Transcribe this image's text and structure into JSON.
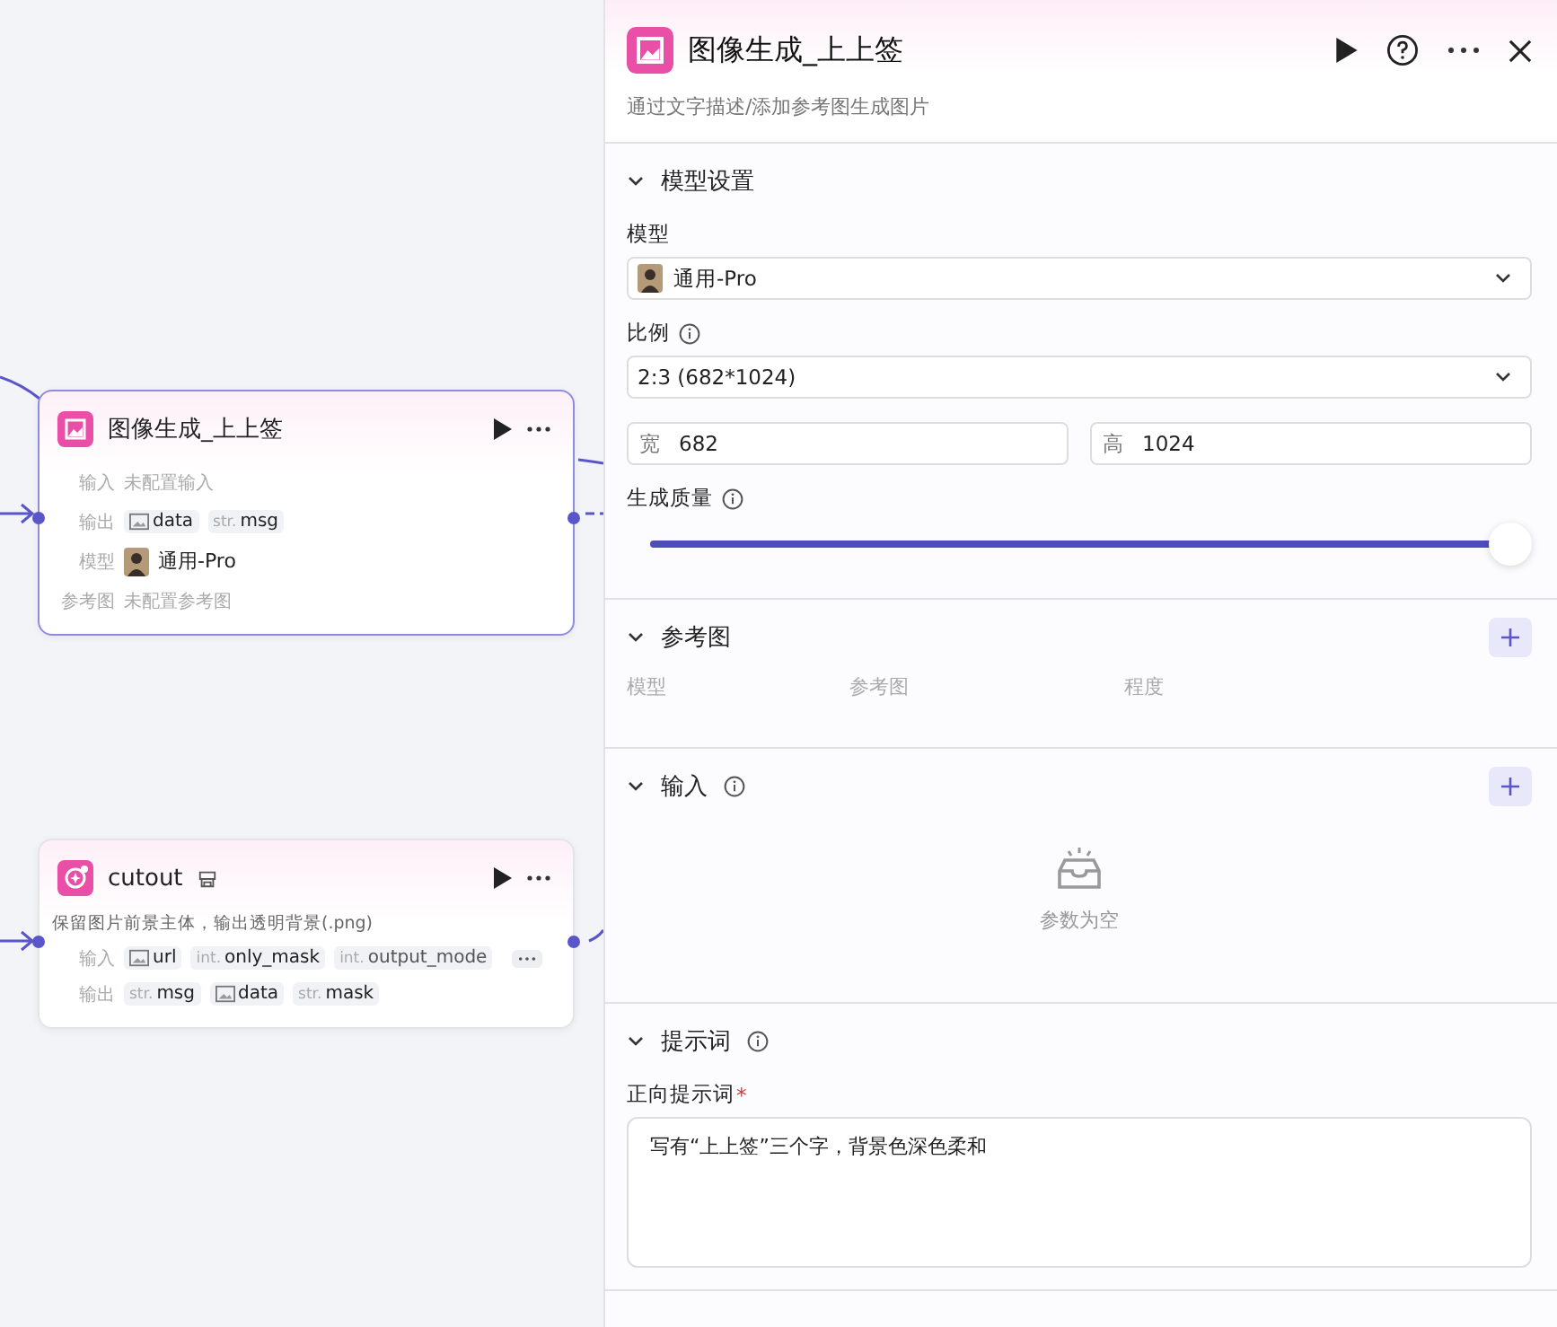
{
  "canvas": {
    "nodes": [
      {
        "title": "图像生成_上上签",
        "badge": false,
        "rows": [
          {
            "label": "输入",
            "kind": "empty",
            "value": "未配置输入"
          },
          {
            "label": "输出",
            "kind": "tags",
            "tags": [
              {
                "kind": "image",
                "name": "data"
              },
              {
                "kind": "typed",
                "prefix": "str.",
                "name": "msg"
              }
            ]
          },
          {
            "label": "模型",
            "kind": "model",
            "value": "通用-Pro"
          },
          {
            "label": "参考图",
            "kind": "empty",
            "value": "未配置参考图"
          }
        ]
      },
      {
        "title": "cutout",
        "badge": true,
        "description": "保留图片前景主体，输出透明背景(.png)",
        "rows": [
          {
            "label": "输入",
            "kind": "tags",
            "more": true,
            "tags": [
              {
                "kind": "image",
                "name": "url"
              },
              {
                "kind": "typed",
                "prefix": "int.",
                "name": "only_mask"
              },
              {
                "kind": "typed",
                "prefix": "int.",
                "name": "output_mode",
                "faded": true
              }
            ]
          },
          {
            "label": "输出",
            "kind": "tags",
            "tags": [
              {
                "kind": "typed",
                "prefix": "str.",
                "name": "msg"
              },
              {
                "kind": "image",
                "name": "data"
              },
              {
                "kind": "typed",
                "prefix": "str.",
                "name": "mask"
              }
            ]
          }
        ]
      }
    ]
  },
  "panel": {
    "title": "图像生成_上上签",
    "description": "通过文字描述/添加参考图生成图片",
    "sections": [
      {
        "kind": "settings",
        "title": "模型设置",
        "info": false,
        "add": false,
        "expanded": true,
        "model": {
          "label": "模型",
          "value": "通用-Pro"
        },
        "ratio": {
          "label": "比例",
          "value": "2:3 (682*1024)"
        },
        "width": {
          "label": "宽",
          "value": "682"
        },
        "height": {
          "label": "高",
          "value": "1024"
        },
        "quality": {
          "label": "生成质量",
          "level": 1
        }
      },
      {
        "kind": "columns",
        "title": "参考图",
        "info": false,
        "add": true,
        "expanded": true,
        "columns": [
          "模型",
          "参考图",
          "程度"
        ]
      },
      {
        "kind": "empty",
        "title": "输入",
        "info": true,
        "add": true,
        "expanded": true,
        "empty_text": "参数为空"
      },
      {
        "kind": "prompt",
        "title": "提示词",
        "info": true,
        "add": false,
        "expanded": true,
        "field": {
          "label": "正向提示词",
          "required_mark": "*",
          "value": "写有“上上签”三个字，背景色深色柔和"
        }
      }
    ]
  }
}
